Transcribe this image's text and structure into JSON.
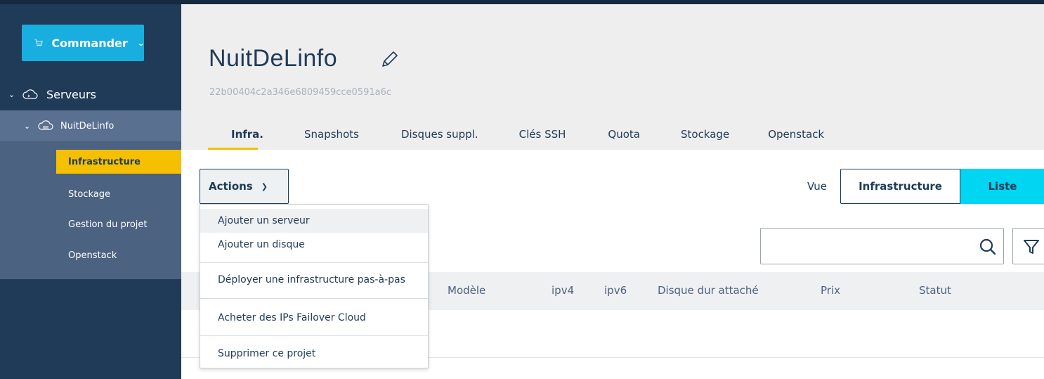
{
  "sidebar": {
    "order_button": {
      "label": "Commander",
      "icon": "cart-icon"
    },
    "servers_label": "Serveurs",
    "project_label": "NuitDeLinfo",
    "items": [
      {
        "label": "Infrastructure",
        "active": true
      },
      {
        "label": "Stockage",
        "active": false
      },
      {
        "label": "Gestion du projet",
        "active": false
      },
      {
        "label": "Openstack",
        "active": false
      }
    ]
  },
  "header": {
    "title": "NuitDeLinfo",
    "project_id": "22b00404c2a346e6809459cce0591a6c",
    "tabs": [
      {
        "label": "Infra.",
        "active": true
      },
      {
        "label": "Snapshots",
        "active": false
      },
      {
        "label": "Disques suppl.",
        "active": false
      },
      {
        "label": "Clés SSH",
        "active": false
      },
      {
        "label": "Quota",
        "active": false
      },
      {
        "label": "Stockage",
        "active": false
      },
      {
        "label": "Openstack",
        "active": false
      }
    ]
  },
  "toolbar": {
    "actions_label": "Actions",
    "view_label": "Vue",
    "view_infra_label": "Infrastructure",
    "view_list_label": "Liste",
    "search_placeholder": ""
  },
  "table": {
    "columns": [
      "Modèle",
      "ipv4",
      "ipv6",
      "Disque dur attaché",
      "Prix",
      "Statut"
    ]
  },
  "actions_menu": {
    "items": [
      "Ajouter un serveur",
      "Ajouter un disque",
      "Déployer une infrastructure pas-à-pas",
      "Acheter des IPs Failover Cloud",
      "Supprimer ce projet"
    ]
  },
  "colors": {
    "sidebar_bg": "#1f3b57",
    "accent_yellow": "#f5c000",
    "accent_blue": "#19aee0",
    "accent_cyan": "#00d5f2"
  }
}
